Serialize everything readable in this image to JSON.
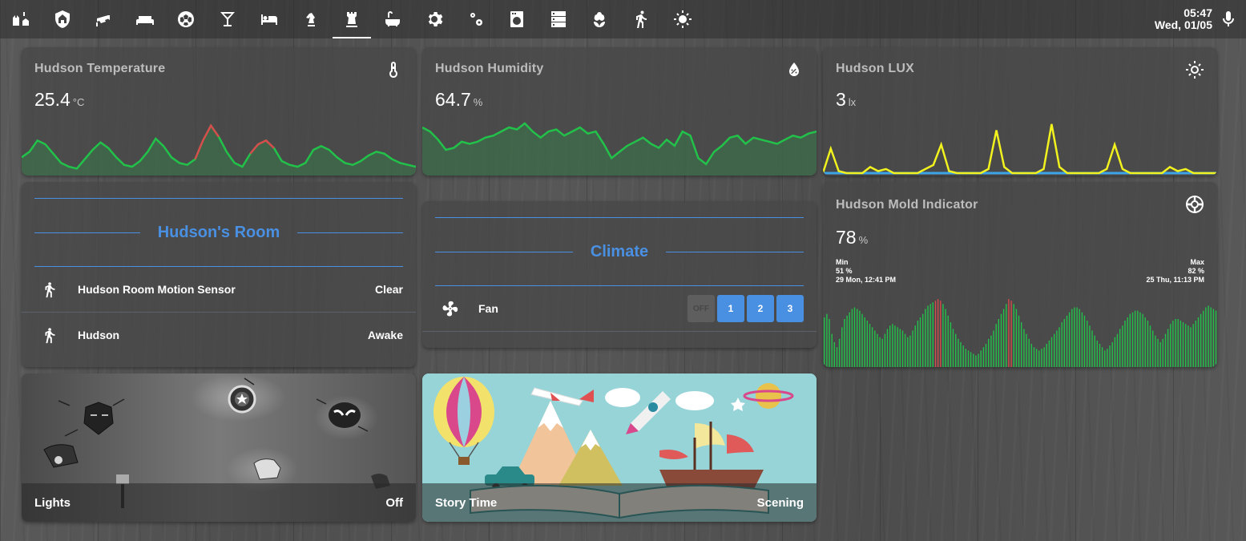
{
  "tabs": [
    {
      "icon": "castle-home-icon"
    },
    {
      "icon": "shield-home-icon"
    },
    {
      "icon": "cctv-icon"
    },
    {
      "icon": "sofa-icon"
    },
    {
      "icon": "soccer-ball-icon"
    },
    {
      "icon": "glass-cocktail-icon"
    },
    {
      "icon": "bed-icon"
    },
    {
      "icon": "chess-knight-icon"
    },
    {
      "icon": "chess-rook-icon",
      "active": true
    },
    {
      "icon": "bathtub-icon"
    },
    {
      "icon": "settings-icon"
    },
    {
      "icon": "settings-multiple-icon"
    },
    {
      "icon": "washing-machine-icon"
    },
    {
      "icon": "server-icon"
    },
    {
      "icon": "flower-icon"
    },
    {
      "icon": "run-icon"
    },
    {
      "icon": "sun-icon"
    }
  ],
  "clock": {
    "time": "05:47",
    "date": "Wed, 01/05"
  },
  "mic": {
    "icon": "microphone-icon"
  },
  "colors": {
    "accent": "#4a90e2",
    "spark_green": "#22c24a",
    "spark_red": "#d64b4b",
    "lux_yellow": "#f2f21e",
    "lux_blue": "#3ea4e8"
  },
  "temperature": {
    "name": "Hudson Temperature",
    "value": "25.4",
    "unit": "°C",
    "icon": "thermometer-icon",
    "history": [
      16,
      22,
      34,
      30,
      20,
      10,
      6,
      4,
      14,
      24,
      32,
      26,
      16,
      8,
      6,
      12,
      22,
      36,
      28,
      16,
      10,
      8,
      14,
      34,
      50,
      38,
      22,
      10,
      6,
      20,
      30,
      34,
      26,
      12,
      8,
      6,
      10,
      24,
      28,
      24,
      16,
      10,
      8,
      12,
      18,
      22,
      20,
      14,
      10,
      8,
      6
    ]
  },
  "humidity": {
    "name": "Hudson Humidity",
    "value": "64.7",
    "unit": "%",
    "icon": "water-percent-icon",
    "history": [
      44,
      40,
      32,
      22,
      24,
      30,
      28,
      30,
      34,
      36,
      40,
      44,
      42,
      48,
      40,
      34,
      40,
      42,
      36,
      40,
      44,
      38,
      40,
      28,
      14,
      20,
      26,
      30,
      34,
      28,
      24,
      32,
      26,
      40,
      36,
      14,
      8,
      20,
      26,
      34,
      36,
      28,
      34,
      32,
      30,
      28,
      32,
      36,
      34,
      38,
      40
    ]
  },
  "lux": {
    "name": "Hudson LUX",
    "value": "3",
    "unit": "lx",
    "icon": "white-balance-sunny-icon",
    "history": [
      0,
      24,
      2,
      0,
      0,
      0,
      6,
      2,
      4,
      0,
      0,
      0,
      0,
      4,
      8,
      28,
      2,
      0,
      0,
      0,
      0,
      4,
      42,
      6,
      0,
      0,
      0,
      0,
      4,
      48,
      6,
      0,
      0,
      0,
      0,
      0,
      4,
      28,
      4,
      0,
      0,
      0,
      0,
      0,
      6,
      2,
      4,
      0,
      0,
      0,
      0
    ]
  },
  "mold": {
    "name": "Hudson Mold Indicator",
    "value": "78",
    "unit": "%",
    "icon": "death-star-icon",
    "min_label": "Min",
    "min_value": "51 %",
    "min_time": "29 Mon, 12:41 PM",
    "max_label": "Max",
    "max_value": "82 %",
    "max_time": "25 Thu, 11:13 PM",
    "history": [
      60,
      64,
      58,
      40,
      30,
      24,
      34,
      48,
      58,
      62,
      66,
      70,
      72,
      70,
      68,
      64,
      60,
      56,
      52,
      48,
      44,
      40,
      36,
      34,
      40,
      46,
      50,
      52,
      50,
      48,
      46,
      44,
      40,
      36,
      38,
      44,
      50,
      56,
      60,
      64,
      70,
      74,
      76,
      78,
      80,
      82,
      80,
      76,
      70,
      62,
      54,
      46,
      40,
      34,
      30,
      26,
      22,
      20,
      18,
      16,
      14,
      16,
      20,
      24,
      28,
      34,
      38,
      44,
      52,
      58,
      64,
      70,
      76,
      82,
      80,
      76,
      70,
      62,
      54,
      46,
      40,
      34,
      28,
      24,
      22,
      20,
      22,
      24,
      28,
      32,
      36,
      40,
      44,
      48,
      54,
      58,
      62,
      66,
      70,
      72,
      72,
      70,
      66,
      62,
      56,
      50,
      44,
      38,
      32,
      28,
      24,
      20,
      22,
      26,
      30,
      36,
      40,
      46,
      50,
      56,
      60,
      64,
      66,
      68,
      68,
      66,
      64,
      60,
      56,
      50,
      44,
      38,
      34,
      30,
      34,
      40,
      46,
      52,
      56,
      58,
      58,
      56,
      54,
      52,
      50,
      48,
      52,
      56,
      60,
      64,
      68,
      72,
      74,
      72,
      70,
      68
    ]
  },
  "hudsons_room": {
    "title": "Hudson's Room",
    "rows": [
      {
        "icon": "walk-icon",
        "name": "Hudson Room Motion Sensor",
        "state": "Clear"
      },
      {
        "icon": "walk-icon",
        "name": "Hudson",
        "state": "Awake"
      }
    ]
  },
  "climate": {
    "title": "Climate",
    "fan_icon": "fan-icon",
    "fan_name": "Fan",
    "buttons": [
      {
        "label": "OFF",
        "off": true
      },
      {
        "label": "1"
      },
      {
        "label": "2"
      },
      {
        "label": "3"
      }
    ]
  },
  "lights": {
    "name": "Lights",
    "state": "Off"
  },
  "story": {
    "name": "Story Time",
    "state": "Scening"
  }
}
